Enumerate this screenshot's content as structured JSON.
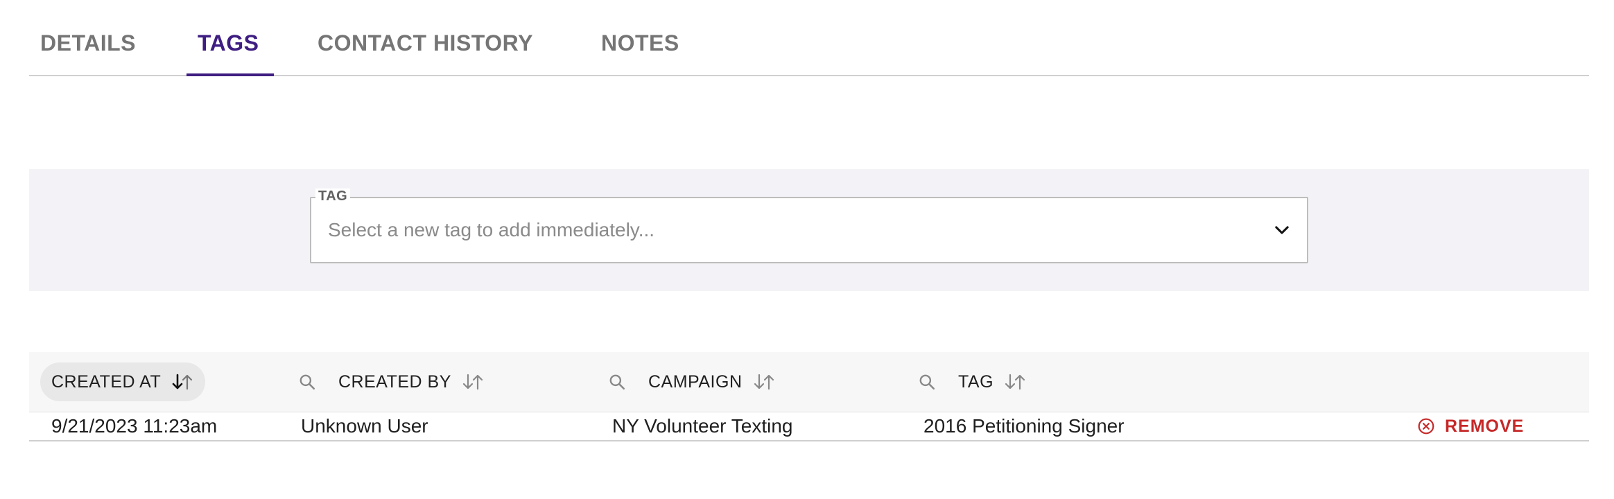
{
  "tabs": [
    {
      "label": "DETAILS",
      "active": false
    },
    {
      "label": "TAGS",
      "active": true
    },
    {
      "label": "CONTACT HISTORY",
      "active": false
    },
    {
      "label": "NOTES",
      "active": false
    }
  ],
  "tag_select": {
    "label": "TAG",
    "placeholder": "Select a new tag to add immediately..."
  },
  "table": {
    "columns": [
      {
        "label": "CREATED AT",
        "sorted": true,
        "searchable": false
      },
      {
        "label": "CREATED BY",
        "sorted": false,
        "searchable": true
      },
      {
        "label": "CAMPAIGN",
        "sorted": false,
        "searchable": true
      },
      {
        "label": "TAG",
        "sorted": false,
        "searchable": true
      }
    ],
    "rows": [
      {
        "created_at": "9/21/2023 11:23am",
        "created_by": "Unknown User",
        "campaign": "NY Volunteer Texting",
        "tag": "2016 Petitioning Signer",
        "action": "REMOVE"
      }
    ]
  },
  "colors": {
    "accent": "#3f1e82",
    "danger": "#c62828",
    "tab_inactive": "#757575",
    "panel_bg": "#f3f2f6"
  },
  "icons": {
    "sort": "sort-arrows-icon",
    "search": "search-icon",
    "dropdown": "chevron-down-icon",
    "remove": "circle-x-icon"
  }
}
